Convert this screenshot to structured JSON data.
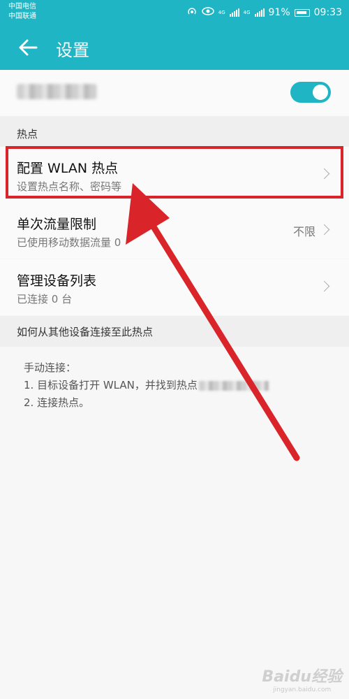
{
  "status_bar": {
    "carrier_1": "中国电信",
    "carrier_2": "中国联通",
    "net_1": "4G",
    "net_2": "4G",
    "battery": "91%",
    "time": "09:33"
  },
  "toolbar": {
    "title": "设置",
    "back_icon": "arrow-left-icon"
  },
  "hotspot_toggle": {
    "enabled": true
  },
  "section_hotspot": {
    "header": "热点",
    "items": [
      {
        "title": "配置 WLAN 热点",
        "subtitle": "设置热点名称、密码等",
        "value": ""
      },
      {
        "title": "单次流量限制",
        "subtitle": "已使用移动数据流量 0",
        "value": "不限"
      },
      {
        "title": "管理设备列表",
        "subtitle": "已连接 0 台",
        "value": ""
      }
    ]
  },
  "section_howto": {
    "header": "如何从其他设备连接至此热点",
    "lines": [
      "手动连接：",
      "1. 目标设备打开 WLAN，并找到热点",
      "2. 连接热点。"
    ]
  },
  "watermark": {
    "logo": "Baidu经验",
    "site": "jingyan.baidu.com"
  },
  "colors": {
    "accent": "#1fb5c4",
    "annotation": "#d9242a"
  }
}
